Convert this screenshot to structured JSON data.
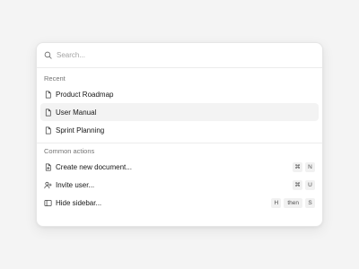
{
  "search": {
    "placeholder": "Search..."
  },
  "groups": {
    "recent": {
      "heading": "Recent",
      "items": [
        {
          "label": "Product Roadmap",
          "icon": "file-icon"
        },
        {
          "label": "User Manual",
          "icon": "file-icon",
          "selected": true
        },
        {
          "label": "Sprint Planning",
          "icon": "file-icon"
        }
      ]
    },
    "actions": {
      "heading": "Common actions",
      "items": [
        {
          "label": "Create new document...",
          "icon": "file-plus-icon",
          "shortcut": [
            "⌘",
            "N"
          ]
        },
        {
          "label": "Invite user...",
          "icon": "user-plus-icon",
          "shortcut": [
            "⌘",
            "U"
          ]
        },
        {
          "label": "Hide sidebar...",
          "icon": "sidebar-icon",
          "shortcut": [
            "H",
            "then",
            "S"
          ]
        }
      ]
    }
  },
  "colors": {
    "background": "#f4f4f4",
    "panel": "#ffffff",
    "selected_row": "#f3f3f3",
    "muted_text": "#737373",
    "kbd_bg": "#f1f1f1"
  }
}
